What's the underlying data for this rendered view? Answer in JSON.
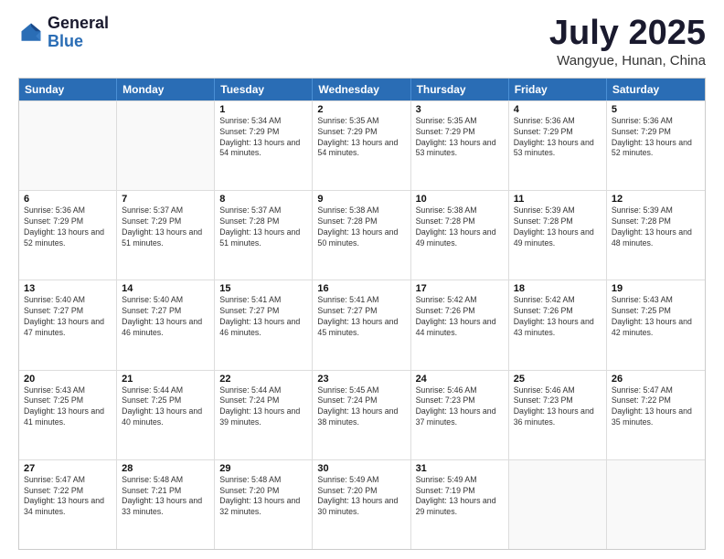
{
  "logo": {
    "general": "General",
    "blue": "Blue"
  },
  "header": {
    "month": "July 2025",
    "location": "Wangyue, Hunan, China"
  },
  "weekdays": [
    "Sunday",
    "Monday",
    "Tuesday",
    "Wednesday",
    "Thursday",
    "Friday",
    "Saturday"
  ],
  "weeks": [
    [
      {
        "day": "",
        "sunrise": "",
        "sunset": "",
        "daylight": ""
      },
      {
        "day": "",
        "sunrise": "",
        "sunset": "",
        "daylight": ""
      },
      {
        "day": "1",
        "sunrise": "Sunrise: 5:34 AM",
        "sunset": "Sunset: 7:29 PM",
        "daylight": "Daylight: 13 hours and 54 minutes."
      },
      {
        "day": "2",
        "sunrise": "Sunrise: 5:35 AM",
        "sunset": "Sunset: 7:29 PM",
        "daylight": "Daylight: 13 hours and 54 minutes."
      },
      {
        "day": "3",
        "sunrise": "Sunrise: 5:35 AM",
        "sunset": "Sunset: 7:29 PM",
        "daylight": "Daylight: 13 hours and 53 minutes."
      },
      {
        "day": "4",
        "sunrise": "Sunrise: 5:36 AM",
        "sunset": "Sunset: 7:29 PM",
        "daylight": "Daylight: 13 hours and 53 minutes."
      },
      {
        "day": "5",
        "sunrise": "Sunrise: 5:36 AM",
        "sunset": "Sunset: 7:29 PM",
        "daylight": "Daylight: 13 hours and 52 minutes."
      }
    ],
    [
      {
        "day": "6",
        "sunrise": "Sunrise: 5:36 AM",
        "sunset": "Sunset: 7:29 PM",
        "daylight": "Daylight: 13 hours and 52 minutes."
      },
      {
        "day": "7",
        "sunrise": "Sunrise: 5:37 AM",
        "sunset": "Sunset: 7:29 PM",
        "daylight": "Daylight: 13 hours and 51 minutes."
      },
      {
        "day": "8",
        "sunrise": "Sunrise: 5:37 AM",
        "sunset": "Sunset: 7:28 PM",
        "daylight": "Daylight: 13 hours and 51 minutes."
      },
      {
        "day": "9",
        "sunrise": "Sunrise: 5:38 AM",
        "sunset": "Sunset: 7:28 PM",
        "daylight": "Daylight: 13 hours and 50 minutes."
      },
      {
        "day": "10",
        "sunrise": "Sunrise: 5:38 AM",
        "sunset": "Sunset: 7:28 PM",
        "daylight": "Daylight: 13 hours and 49 minutes."
      },
      {
        "day": "11",
        "sunrise": "Sunrise: 5:39 AM",
        "sunset": "Sunset: 7:28 PM",
        "daylight": "Daylight: 13 hours and 49 minutes."
      },
      {
        "day": "12",
        "sunrise": "Sunrise: 5:39 AM",
        "sunset": "Sunset: 7:28 PM",
        "daylight": "Daylight: 13 hours and 48 minutes."
      }
    ],
    [
      {
        "day": "13",
        "sunrise": "Sunrise: 5:40 AM",
        "sunset": "Sunset: 7:27 PM",
        "daylight": "Daylight: 13 hours and 47 minutes."
      },
      {
        "day": "14",
        "sunrise": "Sunrise: 5:40 AM",
        "sunset": "Sunset: 7:27 PM",
        "daylight": "Daylight: 13 hours and 46 minutes."
      },
      {
        "day": "15",
        "sunrise": "Sunrise: 5:41 AM",
        "sunset": "Sunset: 7:27 PM",
        "daylight": "Daylight: 13 hours and 46 minutes."
      },
      {
        "day": "16",
        "sunrise": "Sunrise: 5:41 AM",
        "sunset": "Sunset: 7:27 PM",
        "daylight": "Daylight: 13 hours and 45 minutes."
      },
      {
        "day": "17",
        "sunrise": "Sunrise: 5:42 AM",
        "sunset": "Sunset: 7:26 PM",
        "daylight": "Daylight: 13 hours and 44 minutes."
      },
      {
        "day": "18",
        "sunrise": "Sunrise: 5:42 AM",
        "sunset": "Sunset: 7:26 PM",
        "daylight": "Daylight: 13 hours and 43 minutes."
      },
      {
        "day": "19",
        "sunrise": "Sunrise: 5:43 AM",
        "sunset": "Sunset: 7:25 PM",
        "daylight": "Daylight: 13 hours and 42 minutes."
      }
    ],
    [
      {
        "day": "20",
        "sunrise": "Sunrise: 5:43 AM",
        "sunset": "Sunset: 7:25 PM",
        "daylight": "Daylight: 13 hours and 41 minutes."
      },
      {
        "day": "21",
        "sunrise": "Sunrise: 5:44 AM",
        "sunset": "Sunset: 7:25 PM",
        "daylight": "Daylight: 13 hours and 40 minutes."
      },
      {
        "day": "22",
        "sunrise": "Sunrise: 5:44 AM",
        "sunset": "Sunset: 7:24 PM",
        "daylight": "Daylight: 13 hours and 39 minutes."
      },
      {
        "day": "23",
        "sunrise": "Sunrise: 5:45 AM",
        "sunset": "Sunset: 7:24 PM",
        "daylight": "Daylight: 13 hours and 38 minutes."
      },
      {
        "day": "24",
        "sunrise": "Sunrise: 5:46 AM",
        "sunset": "Sunset: 7:23 PM",
        "daylight": "Daylight: 13 hours and 37 minutes."
      },
      {
        "day": "25",
        "sunrise": "Sunrise: 5:46 AM",
        "sunset": "Sunset: 7:23 PM",
        "daylight": "Daylight: 13 hours and 36 minutes."
      },
      {
        "day": "26",
        "sunrise": "Sunrise: 5:47 AM",
        "sunset": "Sunset: 7:22 PM",
        "daylight": "Daylight: 13 hours and 35 minutes."
      }
    ],
    [
      {
        "day": "27",
        "sunrise": "Sunrise: 5:47 AM",
        "sunset": "Sunset: 7:22 PM",
        "daylight": "Daylight: 13 hours and 34 minutes."
      },
      {
        "day": "28",
        "sunrise": "Sunrise: 5:48 AM",
        "sunset": "Sunset: 7:21 PM",
        "daylight": "Daylight: 13 hours and 33 minutes."
      },
      {
        "day": "29",
        "sunrise": "Sunrise: 5:48 AM",
        "sunset": "Sunset: 7:20 PM",
        "daylight": "Daylight: 13 hours and 32 minutes."
      },
      {
        "day": "30",
        "sunrise": "Sunrise: 5:49 AM",
        "sunset": "Sunset: 7:20 PM",
        "daylight": "Daylight: 13 hours and 30 minutes."
      },
      {
        "day": "31",
        "sunrise": "Sunrise: 5:49 AM",
        "sunset": "Sunset: 7:19 PM",
        "daylight": "Daylight: 13 hours and 29 minutes."
      },
      {
        "day": "",
        "sunrise": "",
        "sunset": "",
        "daylight": ""
      },
      {
        "day": "",
        "sunrise": "",
        "sunset": "",
        "daylight": ""
      }
    ]
  ]
}
